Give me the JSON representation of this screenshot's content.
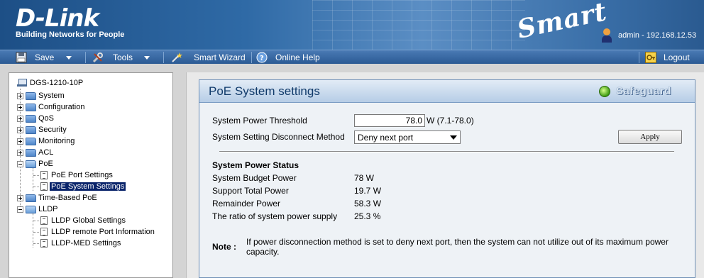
{
  "header": {
    "logo": "D-Link",
    "tagline": "Building Networks for People",
    "product_brand": "Smart",
    "user_info": "admin - 192.168.12.53"
  },
  "toolbar": {
    "save_label": "Save",
    "tools_label": "Tools",
    "smart_wizard_label": "Smart Wizard",
    "online_help_label": "Online Help",
    "logout_label": "Logout"
  },
  "tree": {
    "root": "DGS-1210-10P",
    "items": [
      {
        "label": "System"
      },
      {
        "label": "Configuration"
      },
      {
        "label": "QoS"
      },
      {
        "label": "Security"
      },
      {
        "label": "Monitoring"
      },
      {
        "label": "ACL"
      },
      {
        "label": "PoE"
      },
      {
        "label": "PoE Port Settings"
      },
      {
        "label": "PoE System Settings"
      },
      {
        "label": "Time-Based PoE"
      },
      {
        "label": "LLDP"
      },
      {
        "label": "LLDP Global Settings"
      },
      {
        "label": "LLDP remote Port Information"
      },
      {
        "label": "LLDP-MED Settings"
      }
    ]
  },
  "panel": {
    "title": "PoE System settings",
    "safeguard_label": "Safeguard",
    "threshold_label": "System Power Threshold",
    "threshold_value": "78.0",
    "threshold_unit": "W (7.1-78.0)",
    "method_label": "System Setting Disconnect Method",
    "method_value": "Deny next port",
    "apply_label": "Apply",
    "status_heading": "System Power Status",
    "status": [
      {
        "label": "System Budget Power",
        "value": "78 W"
      },
      {
        "label": "Support Total Power",
        "value": "19.7 W"
      },
      {
        "label": "Remainder Power",
        "value": "58.3 W"
      },
      {
        "label": "The ratio of system power supply",
        "value": "25.3 %"
      }
    ],
    "note_label": "Note :",
    "note_text": "If power disconnection method is set to deny next port, then the system can not utilize out of its maximum power capacity."
  },
  "colors": {
    "banner": "#2f6aa6",
    "toolbar": "#2b5a94",
    "selected": "#0a246a",
    "title_text": "#103a6a"
  }
}
